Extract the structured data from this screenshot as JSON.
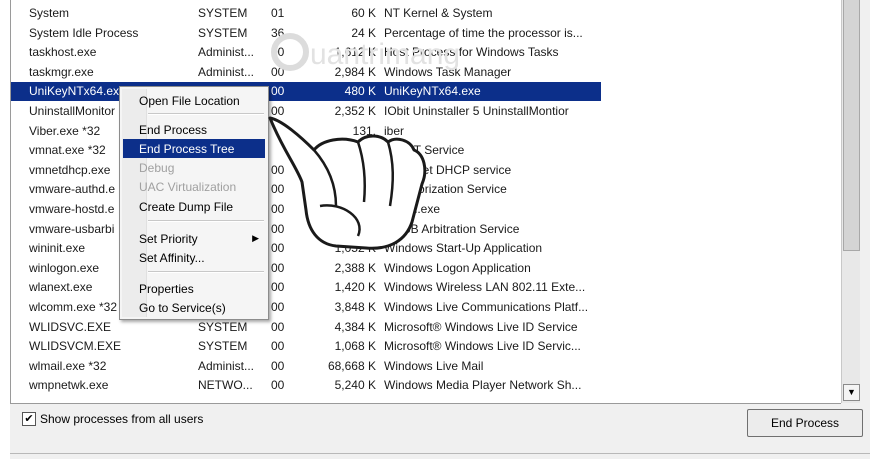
{
  "processes": [
    {
      "name": "System",
      "user": "SYSTEM",
      "cpu": "01",
      "mem": "60 K",
      "desc": "NT Kernel & System"
    },
    {
      "name": "System Idle Process",
      "user": "SYSTEM",
      "cpu": "36",
      "mem": "24 K",
      "desc": "Percentage of time the processor is..."
    },
    {
      "name": "taskhost.exe",
      "user": "Administ...",
      "cpu": "00",
      "mem": "1,612 K",
      "desc": "Host Process for Windows Tasks"
    },
    {
      "name": "taskmgr.exe",
      "user": "Administ...",
      "cpu": "00",
      "mem": "2,984 K",
      "desc": "Windows Task Manager"
    },
    {
      "name": "UniKeyNTx64.exe",
      "user": "",
      "cpu": "00",
      "mem": "480 K",
      "desc": "UniKeyNTx64.exe"
    },
    {
      "name": "UninstallMonitor",
      "user": "",
      "cpu": "00",
      "mem": "2,352 K",
      "desc": "IObit Uninstaller 5 UninstallMontior"
    },
    {
      "name": "Viber.exe *32",
      "user": "",
      "cpu": "",
      "mem": "131,",
      "desc": "iber"
    },
    {
      "name": "vmnat.exe *32",
      "user": "",
      "cpu": "",
      "mem": "",
      "desc": "re NAT Service"
    },
    {
      "name": "vmnetdhcp.exe",
      "user": "",
      "cpu": "00",
      "mem": "",
      "desc": "re VMnet DHCP service"
    },
    {
      "name": "vmware-authd.e",
      "user": "",
      "cpu": "00",
      "mem": "",
      "desc": "e Authorization Service"
    },
    {
      "name": "vmware-hostd.e",
      "user": "",
      "cpu": "00",
      "mem": "",
      "desc": "-hostd.exe"
    },
    {
      "name": "vmware-usbarbi",
      "user": "",
      "cpu": "00",
      "mem": "",
      "desc": "e USB Arbitration Service"
    },
    {
      "name": "wininit.exe",
      "user": "",
      "cpu": "00",
      "mem": "1,052 K",
      "desc": "Windows Start-Up Application"
    },
    {
      "name": "winlogon.exe",
      "user": "",
      "cpu": "00",
      "mem": "2,388 K",
      "desc": "Windows Logon Application"
    },
    {
      "name": "wlanext.exe",
      "user": "",
      "cpu": "00",
      "mem": "1,420 K",
      "desc": "Windows Wireless LAN 802.11 Exte..."
    },
    {
      "name": "wlcomm.exe *32",
      "user": "",
      "cpu": "00",
      "mem": "3,848 K",
      "desc": "Windows Live Communications Platf..."
    },
    {
      "name": "WLIDSVC.EXE",
      "user": "SYSTEM",
      "cpu": "00",
      "mem": "4,384 K",
      "desc": "Microsoft® Windows Live ID Service"
    },
    {
      "name": "WLIDSVCM.EXE",
      "user": "SYSTEM",
      "cpu": "00",
      "mem": "1,068 K",
      "desc": "Microsoft® Windows Live ID Servic..."
    },
    {
      "name": "wlmail.exe *32",
      "user": "Administ...",
      "cpu": "00",
      "mem": "68,668 K",
      "desc": "Windows Live Mail"
    },
    {
      "name": "wmpnetwk.exe",
      "user": "NETWO...",
      "cpu": "00",
      "mem": "5,240 K",
      "desc": "Windows Media Player Network Sh..."
    }
  ],
  "selected_index": 4,
  "context_menu": {
    "items": [
      {
        "label": "Open File Location",
        "state": "normal"
      },
      {
        "label": "End Process",
        "state": "normal"
      },
      {
        "label": "End Process Tree",
        "state": "highlighted"
      },
      {
        "label": "Debug",
        "state": "disabled"
      },
      {
        "label": "UAC Virtualization",
        "state": "disabled"
      },
      {
        "label": "Create Dump File",
        "state": "normal"
      },
      {
        "label": "Set Priority",
        "state": "normal",
        "submenu": true
      },
      {
        "label": "Set Affinity...",
        "state": "normal"
      },
      {
        "label": "Properties",
        "state": "normal"
      },
      {
        "label": "Go to Service(s)",
        "state": "normal"
      }
    ]
  },
  "footer": {
    "show_all_label": "Show processes from all users",
    "show_all_checked": true,
    "end_process_label": "End Process"
  },
  "colors": {
    "selection": "#0c2f8a",
    "watermark": "#dcdcdc"
  },
  "icons": [
    "chevron-down-icon",
    "check-icon",
    "submenu-arrow-icon",
    "pointing-hand-icon"
  ]
}
